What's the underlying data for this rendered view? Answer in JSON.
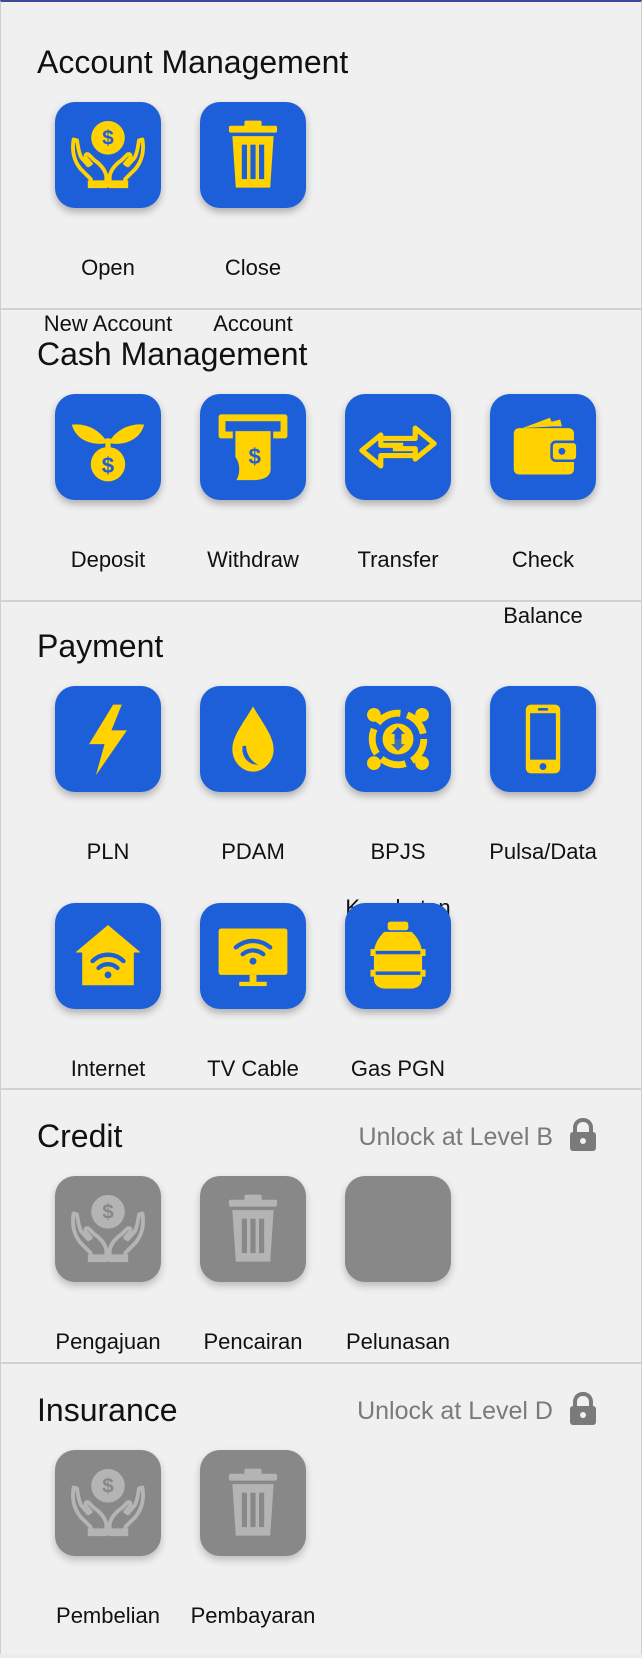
{
  "colors": {
    "accent": "#1c5fd9",
    "icon_fill": "#ffd200",
    "locked": "#888888",
    "locked_icon": "#b4b4b4"
  },
  "sections": {
    "account": {
      "title": "Account Management",
      "items": [
        {
          "label_1": "Open",
          "label_2": "New Account",
          "icon": "money-hands-icon"
        },
        {
          "label_1": "Close",
          "label_2": "Account",
          "icon": "trash-icon"
        }
      ]
    },
    "cash": {
      "title": "Cash Management",
      "items": [
        {
          "label_1": "Deposit",
          "label_2": "",
          "icon": "money-sprout-icon"
        },
        {
          "label_1": "Withdraw",
          "label_2": "",
          "icon": "atm-withdraw-icon"
        },
        {
          "label_1": "Transfer",
          "label_2": "",
          "icon": "transfer-arrows-icon"
        },
        {
          "label_1": "Check",
          "label_2": "Balance",
          "icon": "wallet-icon"
        }
      ]
    },
    "payment": {
      "title": "Payment",
      "items": [
        {
          "label_1": "PLN",
          "label_2": "",
          "icon": "lightning-icon"
        },
        {
          "label_1": "PDAM",
          "label_2": "",
          "icon": "water-drop-icon"
        },
        {
          "label_1": "BPJS",
          "label_2": "Kesehatan",
          "icon": "bpjs-logo-icon"
        },
        {
          "label_1": "Pulsa/Data",
          "label_2": "",
          "icon": "smartphone-icon"
        },
        {
          "label_1": "Internet",
          "label_2": "",
          "icon": "home-wifi-icon"
        },
        {
          "label_1": "TV Cable",
          "label_2": "",
          "icon": "tv-wifi-icon"
        },
        {
          "label_1": "Gas PGN",
          "label_2": "",
          "icon": "gas-cylinder-icon"
        }
      ]
    },
    "credit": {
      "title": "Credit",
      "lock_text": "Unlock at Level B",
      "items": [
        {
          "label_1": "Pengajuan",
          "label_2": "",
          "icon": "money-hands-icon"
        },
        {
          "label_1": "Pencairan",
          "label_2": "",
          "icon": "trash-icon"
        },
        {
          "label_1": "Pelunasan",
          "label_2": "",
          "icon": ""
        }
      ]
    },
    "insurance": {
      "title": "Insurance",
      "lock_text": "Unlock at Level D",
      "items": [
        {
          "label_1": "Pembelian",
          "label_2": "",
          "icon": "money-hands-icon"
        },
        {
          "label_1": "Pembayaran",
          "label_2": "",
          "icon": "trash-icon"
        }
      ]
    }
  }
}
